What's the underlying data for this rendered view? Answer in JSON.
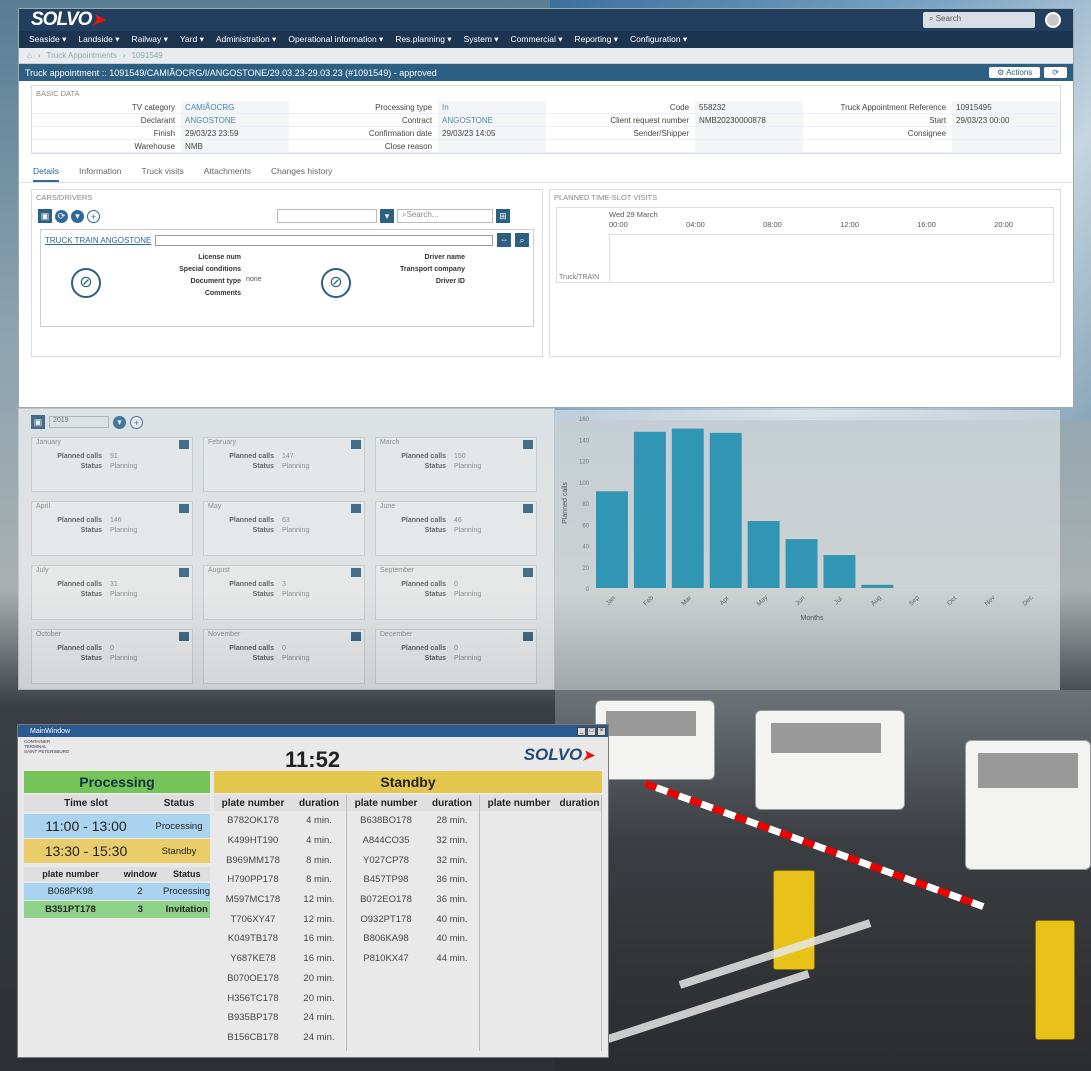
{
  "app": {
    "logo": "SOLVO",
    "search_placeholder": "Search",
    "menu": [
      "Seaside ▾",
      "Landside ▾",
      "Railway ▾",
      "Yard ▾",
      "Administration ▾",
      "Operational information ▾",
      "Res.planning ▾",
      "System ▾",
      "Commercial ▾",
      "Reporting ▾",
      "Configuration ▾"
    ],
    "breadcrumb": [
      "Truck Appointments",
      "1091549"
    ],
    "title": "Truck appointment :: 1091549/CAMIÃOCRG/I/ANGOSTONE/29.03.23-29.03.23 (#1091549) - approved",
    "actions_label": "Actions",
    "basic_title": "BASIC DATA",
    "basic_fields": [
      {
        "k": "TV category",
        "v": "CAMIÃOCRG"
      },
      {
        "k": "Processing type",
        "v": "In"
      },
      {
        "k": "Code",
        "v": "558232"
      },
      {
        "k": "Truck Appointment Reference",
        "v": "10915495"
      },
      {
        "k": "Declarant",
        "v": "ANGOSTONE"
      },
      {
        "k": "Contract",
        "v": "ANGOSTONE"
      },
      {
        "k": "Client request number",
        "v": "NMB20230000878"
      },
      {
        "k": "Start",
        "v": "29/03/23 00:00"
      },
      {
        "k": "Finish",
        "v": "29/03/23 23:59"
      },
      {
        "k": "Confirmation date",
        "v": "29/03/23 14:05"
      },
      {
        "k": "Sender/Shipper",
        "v": ""
      },
      {
        "k": "Consignee",
        "v": ""
      },
      {
        "k": "Warehouse",
        "v": "NMB"
      },
      {
        "k": "Close reason",
        "v": ""
      },
      {
        "k": "",
        "v": ""
      },
      {
        "k": "",
        "v": ""
      }
    ],
    "tabs": [
      "Details",
      "Information",
      "Truck visits",
      "Attachments",
      "Changes history"
    ],
    "cars_title": "CARS/DRIVERS",
    "cars_search": "Search...",
    "cars_item": "TRUCK TRAIN ANGOSTONE",
    "cars_fields_left": [
      "License num",
      "Special conditions",
      "Document type",
      "Comments"
    ],
    "special_conditions_value": "none",
    "cars_fields_right": [
      "Driver name",
      "Transport company",
      "Driver ID"
    ],
    "slots_title": "PLANNED TIME-SLOT VISITS",
    "slots_date": "Wed 29 March",
    "slots_hours": [
      "00:00",
      "04:00",
      "08:00",
      "12:00",
      "16:00",
      "20:00"
    ],
    "slots_row": "Truck/TRAIN"
  },
  "calendar": {
    "year": "2019",
    "months": [
      {
        "name": "January",
        "planned": "91",
        "status": "Planning"
      },
      {
        "name": "February",
        "planned": "147",
        "status": "Planning"
      },
      {
        "name": "March",
        "planned": "150",
        "status": "Planning"
      },
      {
        "name": "April",
        "planned": "146",
        "status": "Planning"
      },
      {
        "name": "May",
        "planned": "63",
        "status": "Planning"
      },
      {
        "name": "June",
        "planned": "46",
        "status": "Planning"
      },
      {
        "name": "July",
        "planned": "31",
        "status": "Planning"
      },
      {
        "name": "August",
        "planned": "3",
        "status": "Planning"
      },
      {
        "name": "September",
        "planned": "0",
        "status": "Planning"
      },
      {
        "name": "October",
        "planned": "0",
        "status": "Planning"
      },
      {
        "name": "November",
        "planned": "0",
        "status": "Planning"
      },
      {
        "name": "December",
        "planned": "0",
        "status": "Planning"
      }
    ],
    "planned_label": "Planned calls",
    "status_label": "Status"
  },
  "chart_data": {
    "type": "bar",
    "categories": [
      "Jan",
      "Feb",
      "Mar",
      "Apr",
      "May",
      "Jun",
      "Jul",
      "Aug",
      "Sep",
      "Oct",
      "Nov",
      "Dec"
    ],
    "values": [
      91,
      147,
      150,
      146,
      63,
      46,
      31,
      3,
      0,
      0,
      0,
      0
    ],
    "xlabel": "Months",
    "ylabel": "Planned calls",
    "ylim": [
      0,
      160
    ],
    "yticks": [
      0,
      20,
      40,
      60,
      80,
      100,
      120,
      140,
      160
    ],
    "color": "#1f8fb0",
    "grid": true
  },
  "monitor": {
    "window_title": "MainWindow",
    "terminal": [
      "CONTAINER",
      "TERMINAL",
      "SAINT PETERSBURG"
    ],
    "clock": "11:52",
    "logo": "SOLVO",
    "processing_header": "Processing",
    "standby_header": "Standby",
    "slot_headers": [
      "Time slot",
      "Status"
    ],
    "slots": [
      {
        "time": "11:00 - 13:00",
        "status": "Processing",
        "color": "#a9d3ef"
      },
      {
        "time": "13:30 - 15:30",
        "status": "Standby",
        "color": "#e8cd6a"
      }
    ],
    "truck_headers": [
      "plate number",
      "window",
      "Status"
    ],
    "trucks": [
      {
        "plate": "B068PK98",
        "window": "2",
        "status": "Processing",
        "color": "#a9d3ef"
      },
      {
        "plate": "B351PT178",
        "window": "3",
        "status": "Invitation",
        "color": "#8fd28a"
      }
    ],
    "standby_headers": [
      "plate number",
      "duration",
      "plate number",
      "duration",
      "plate number",
      "duration"
    ],
    "standby_col1": [
      [
        "B782OK178",
        "4 min."
      ],
      [
        "K499HT190",
        "4 min."
      ],
      [
        "B969MM178",
        "8 min."
      ],
      [
        "H790PP178",
        "8 min."
      ],
      [
        "M597MC178",
        "12 min."
      ],
      [
        "T706XY47",
        "12 min."
      ],
      [
        "K049TB178",
        "16 min."
      ],
      [
        "Y687KE78",
        "16 min."
      ],
      [
        "B070OE178",
        "20 min."
      ],
      [
        "H356TC178",
        "20 min."
      ],
      [
        "B935BP178",
        "24 min."
      ],
      [
        "B156CB178",
        "24 min."
      ]
    ],
    "standby_col2": [
      [
        "B638BO178",
        "28 min."
      ],
      [
        "A844CO35",
        "32 min."
      ],
      [
        "Y027CP78",
        "32 min."
      ],
      [
        "B457TP98",
        "36 min."
      ],
      [
        "B072EO178",
        "36 min."
      ],
      [
        "O932PT178",
        "40 min."
      ],
      [
        "B806KA98",
        "40 min."
      ],
      [
        "P810KX47",
        "44 min."
      ]
    ]
  }
}
